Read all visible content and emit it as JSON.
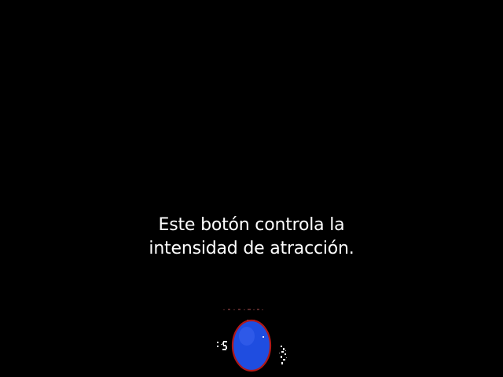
{
  "tutorial": {
    "line1": "Este botón controla la",
    "line2": "intensidad de atracción."
  },
  "control": {
    "icon": "attraction-button",
    "fill_color": "#1f4de0",
    "ring_color": "#b01818"
  }
}
